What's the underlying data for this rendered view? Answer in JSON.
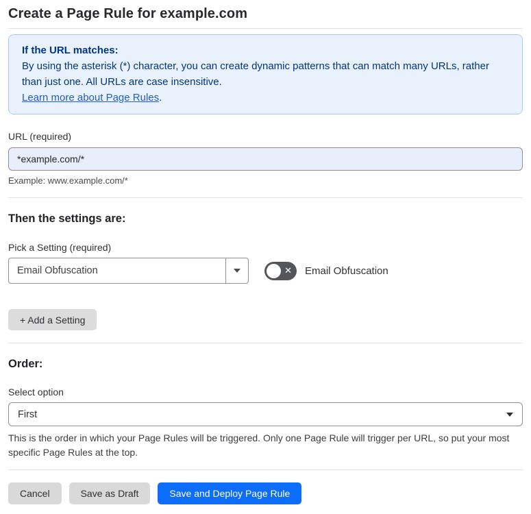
{
  "page": {
    "title": "Create a Page Rule for example.com"
  },
  "info_box": {
    "heading": "If the URL matches:",
    "body": "By using the asterisk (*) character, you can create dynamic patterns that can match many URLs, rather than just one. All URLs are case insensitive.",
    "link_label": "Learn more about Page Rules",
    "link_suffix": "."
  },
  "url_section": {
    "label": "URL (required)",
    "value": "*example.com/*",
    "helper": "Example: www.example.com/*"
  },
  "settings_section": {
    "heading": "Then the settings are:",
    "picker_label": "Pick a Setting (required)",
    "selected_setting": "Email Obfuscation",
    "toggle_label": "Email Obfuscation",
    "toggle_state": "off",
    "toggle_glyph": "✕",
    "add_setting_label": "+ Add a Setting"
  },
  "order_section": {
    "heading": "Order:",
    "select_label": "Select option",
    "selected_option": "First",
    "helper": "This is the order in which your Page Rules will be triggered. Only one Page Rule will trigger per URL, so put your most specific Page Rules at the top."
  },
  "footer": {
    "cancel_label": "Cancel",
    "save_draft_label": "Save as Draft",
    "save_deploy_label": "Save and Deploy Page Rule"
  },
  "colors": {
    "primary_blue": "#0b6dfa",
    "info_bg": "#e9f2fc",
    "info_border": "#abcbed",
    "info_text": "#003681",
    "link_blue": "#1d5fc4",
    "input_bg": "#e8eefb",
    "toggle_bg": "#55555c",
    "button_gray": "#d9d9d9"
  }
}
